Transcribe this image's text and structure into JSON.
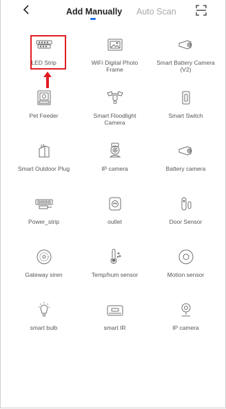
{
  "header": {
    "tabs": [
      {
        "label": "Add Manually",
        "active": true
      },
      {
        "label": "Auto Scan",
        "active": false
      }
    ],
    "accent_color": "#1e6ff0"
  },
  "devices": [
    {
      "label": "LED Strip",
      "icon": "led-strip-icon"
    },
    {
      "label": "WiFi Digital Photo Frame",
      "icon": "photo-frame-icon"
    },
    {
      "label": "Smart Battery Camera (V2)",
      "icon": "battery-camera-icon"
    },
    {
      "label": "Pet Feeder",
      "icon": "pet-feeder-icon"
    },
    {
      "label": "Smart Floodlight Camera",
      "icon": "floodlight-camera-icon"
    },
    {
      "label": "Smart Switch",
      "icon": "switch-icon"
    },
    {
      "label": "Smart Outdoor Plug",
      "icon": "outdoor-plug-icon"
    },
    {
      "label": "IP camera",
      "icon": "ip-camera-icon"
    },
    {
      "label": "Battery camera",
      "icon": "battery-camera-icon"
    },
    {
      "label": "Power_strip",
      "icon": "power-strip-icon"
    },
    {
      "label": "outlet",
      "icon": "outlet-icon"
    },
    {
      "label": "Door Sensor",
      "icon": "door-sensor-icon"
    },
    {
      "label": "Gateway siren",
      "icon": "siren-icon"
    },
    {
      "label": "Temp/hum sensor",
      "icon": "thermometer-icon"
    },
    {
      "label": "Motion sensor",
      "icon": "motion-sensor-icon"
    },
    {
      "label": "smart bulb",
      "icon": "bulb-icon"
    },
    {
      "label": "smart IR",
      "icon": "ir-remote-icon"
    },
    {
      "label": "IP camera",
      "icon": "webcam-icon"
    }
  ],
  "annotation": {
    "highlight_color": "#e11b22",
    "target": "LED Strip"
  }
}
